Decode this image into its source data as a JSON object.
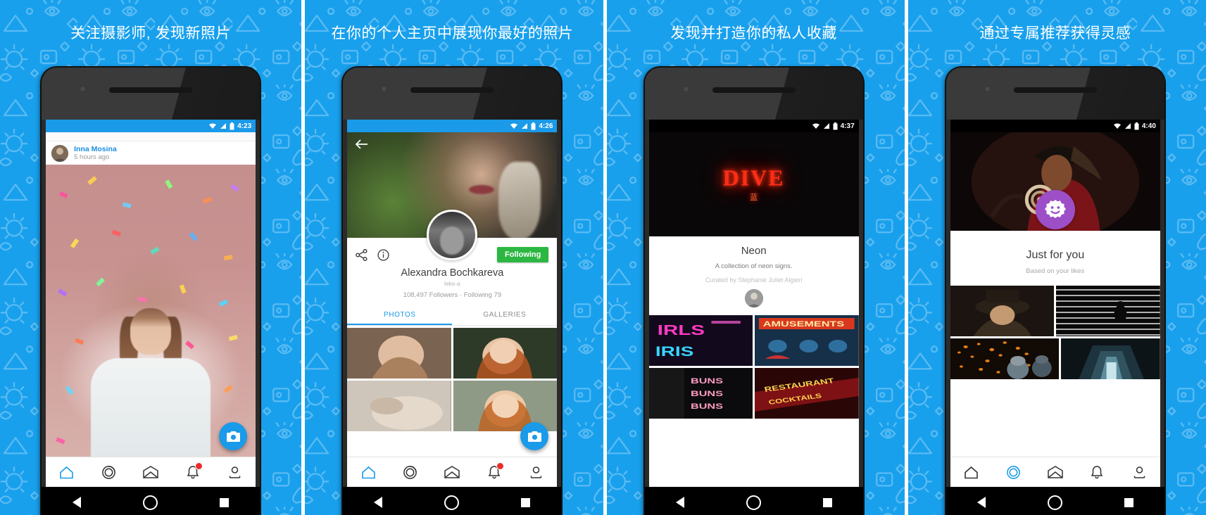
{
  "theme": {
    "brand_blue": "#1a9ae8",
    "follow_green": "#2cb742",
    "badge_purple": "#9c4fc6",
    "notif_red": "#ea2c2c",
    "neon_red": "#ff2d16"
  },
  "panels": [
    {
      "headline": "关注摄影师, 发现新照片",
      "status_time": "4:23",
      "feed": {
        "user_name": "Inna Mosina",
        "timestamp": "5 hours ago"
      },
      "fab_icon": "camera-icon",
      "nav": [
        {
          "icon": "home-icon",
          "active": true,
          "badge": false
        },
        {
          "icon": "circles-icon",
          "active": false,
          "badge": false
        },
        {
          "icon": "envelope-icon",
          "active": false,
          "badge": false
        },
        {
          "icon": "bell-icon",
          "active": false,
          "badge": true
        },
        {
          "icon": "person-icon",
          "active": false,
          "badge": false
        }
      ]
    },
    {
      "headline": "在你的个人主页中展现你最好的照片",
      "status_time": "4:26",
      "profile": {
        "back_icon": "back-arrow-icon",
        "share_icon": "share-icon",
        "info_icon": "info-icon",
        "follow_label": "Following",
        "name": "Alexandra Bochkareva",
        "handle": "leks-a",
        "stats": "108,497 Followers  ·  Following 79",
        "tabs": [
          {
            "label": "PHOTOS",
            "active": true
          },
          {
            "label": "GALLERIES",
            "active": false
          }
        ]
      },
      "fab_icon": "camera-icon",
      "nav": [
        {
          "icon": "home-icon",
          "active": true,
          "badge": false
        },
        {
          "icon": "circles-icon",
          "active": false,
          "badge": false
        },
        {
          "icon": "envelope-icon",
          "active": false,
          "badge": false
        },
        {
          "icon": "bell-icon",
          "active": false,
          "badge": true
        },
        {
          "icon": "person-icon",
          "active": false,
          "badge": false
        }
      ]
    },
    {
      "headline": "发现并打造你的私人收藏",
      "status_time": "4:37",
      "collection": {
        "neon_text": "DIVE",
        "neon_sub": "蓝",
        "title": "Neon",
        "description": "A collection of neon signs.",
        "curator": "Curated by Stephanie Juliet Algieri",
        "tiles": [
          {
            "label": "IRLS",
            "kind": "neon-pink"
          },
          {
            "label": "AMUSEMENTS",
            "kind": "neon-arcade"
          },
          {
            "label": "BUNS BUNS BUNS",
            "kind": "neon-buns"
          },
          {
            "label": "RESTAURANT",
            "kind": "neon-restaurant"
          }
        ]
      },
      "nav": []
    },
    {
      "headline": "通过专属推荐获得灵感",
      "status_time": "4:40",
      "just_for_you": {
        "badge_icon": "smiley-gear-icon",
        "title": "Just for you",
        "subtitle": "Based on your likes"
      },
      "nav": [
        {
          "icon": "home-icon",
          "active": false,
          "badge": false
        },
        {
          "icon": "circles-icon",
          "active": true,
          "badge": false
        },
        {
          "icon": "envelope-icon",
          "active": false,
          "badge": false
        },
        {
          "icon": "bell-icon",
          "active": false,
          "badge": false
        },
        {
          "icon": "person-icon",
          "active": false,
          "badge": false
        }
      ]
    }
  ],
  "system_nav": {
    "back": "back-triangle",
    "home": "home-circle",
    "recents": "recents-square"
  }
}
